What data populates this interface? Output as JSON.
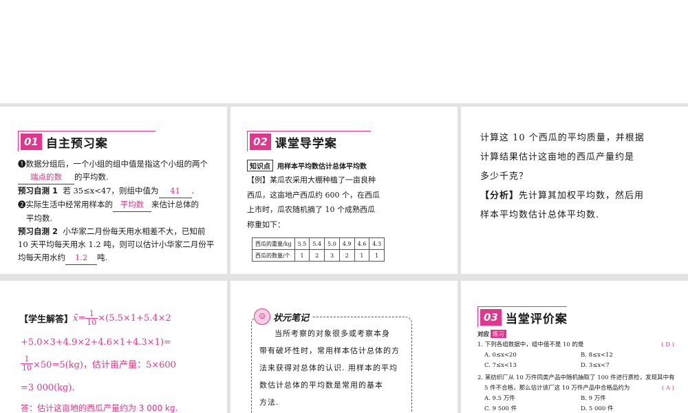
{
  "sec1": {
    "num": "01",
    "title": "自主预习案",
    "l1a": "❶数据分组后，一个小组的组中值是指这个小组的两个",
    "l1b_blank": "端点的数",
    "l1b_tail": "的平均数.",
    "l2_label": "预习自测 1",
    "l2_text": "若 35≤x<47，则组中值为",
    "l2_blank": "41",
    "l2_tail": ".",
    "l3_head": "❷实际生活中经常用样本的",
    "l3_blank": "平均数",
    "l3_tail": "来估计总体的",
    "l4": "平均数.",
    "l5_label": "预习自测 2",
    "l5_text": "小华家二月份每天用水相差不大，已知前",
    "l6": "10 天平均每天用水 1.2 吨，则可以估计小华家二月份平",
    "l7_head": "均每天用水约",
    "l7_blank": "1.2",
    "l7_tail": "吨."
  },
  "sec2": {
    "num": "02",
    "title": "课堂导学案",
    "tag": "知识点",
    "tag_title": "用样本平均数估计总体平均数",
    "ex1": "【例】某瓜农采用大棚种植了一亩良种",
    "ex2": "西瓜，这亩地产西瓜约 600 个，在西瓜",
    "ex3": "上市时，瓜农随机摘了 10 个成熟西瓜",
    "ex4": "称重如下：",
    "table": {
      "row1_label": "西瓜的重量/kg",
      "row1": [
        "5.5",
        "5.4",
        "5.0",
        "4.9",
        "4.6",
        "4.3"
      ],
      "row2_label": "西瓜的数量/个",
      "row2": [
        "1",
        "2",
        "3",
        "2",
        "1",
        "1"
      ]
    }
  },
  "sec3": {
    "l1": "计算这 10 个西瓜的平均质量，并根据",
    "l2": "计算结果估计这亩地的西瓜产量约是",
    "l3": "多少千克？",
    "l4_label": "【分析】",
    "l4": "先计算其加权平均数，然后用",
    "l5": "样本平均数估计总体平均数."
  },
  "sec4": {
    "label": "【学生解答】",
    "x": "x̄",
    "eq": "=",
    "frac1_n": "1",
    "frac1_d": "10",
    "m1": "×(5.5×1+5.4×2",
    "m2": "+5.0×3+4.9×2+4.6×1+4.3×1)=",
    "frac2_n": "1",
    "frac2_d": "10",
    "m3": "×50=5(kg)，估计亩产量：5×600",
    "m4": "=3 000(kg).",
    "m5": "答：估计这亩地的西瓜产量约为 3 000 kg."
  },
  "sec5": {
    "badge": "状元笔记",
    "l1": "当所考察的对象很多或考察本身",
    "l2": "带有破坏性时，常用样本估计总体的方",
    "l3": "法来获得对总体的认识. 用样本的平均",
    "l4": "数估计总体的平均数是常用的基本",
    "l5": "方法."
  },
  "sec6": {
    "num": "03",
    "title": "当堂评价案",
    "tag1": "对应",
    "tag2": "练习",
    "q1": "1. 下列各组数据中，组中值不是 10 的是",
    "q1_ans": "( D )",
    "q1_a": "A. 0≤x<20",
    "q1_b": "B. 8≤x<12",
    "q1_c": "C. 7≤x<13",
    "q1_d": "D. 3≤x<7",
    "q2_1": "2. 某纺织厂从 10 万件同类产品中随机抽取了 100 件进行质检，发现其中有",
    "q2_2": "5 件不合格，那么估计该厂这 10 万件产品中合格品约为",
    "q2_ans": "( A )",
    "q2_a": "A. 9.5 万件",
    "q2_b": "B. 9 万件",
    "q2_c": "C. 9 500 件",
    "q2_d": "D. 5 000 件"
  }
}
